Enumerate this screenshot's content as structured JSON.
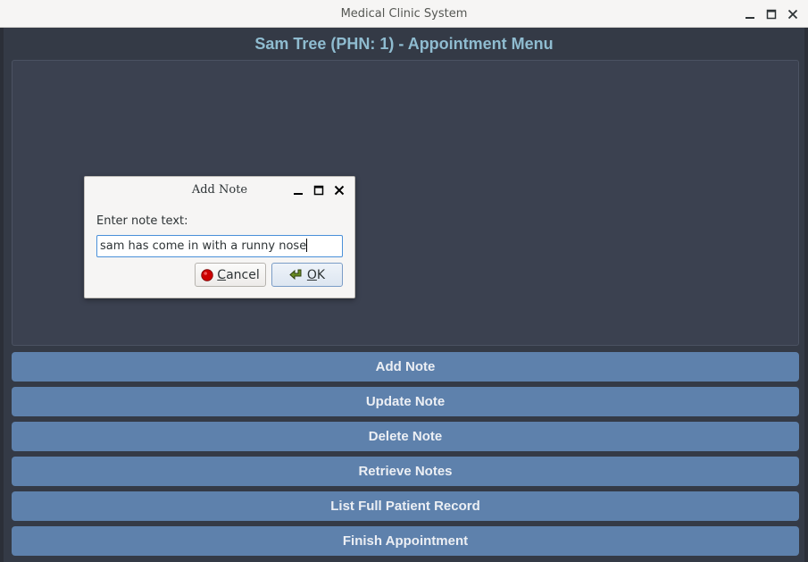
{
  "window": {
    "title": "Medical Clinic System"
  },
  "app": {
    "heading": "Sam Tree (PHN: 1) - Appointment Menu",
    "buttons": [
      {
        "label": "Add Note"
      },
      {
        "label": "Update Note"
      },
      {
        "label": "Delete Note"
      },
      {
        "label": "Retrieve Notes"
      },
      {
        "label": "List Full Patient Record"
      },
      {
        "label": "Finish Appointment"
      }
    ]
  },
  "dialog": {
    "title": "Add Note",
    "prompt": "Enter note text:",
    "input_value": "sam has come in with a runny nose",
    "cancel_label": "Cancel",
    "ok_label": "OK"
  },
  "icons": {
    "minimize": "minimize-icon",
    "maximize": "maximize-icon",
    "close": "close-icon",
    "cancel": "stop-circle-icon",
    "ok": "enter-arrow-icon"
  },
  "colors": {
    "app_background": "#343a46",
    "heading": "#8fbcd0",
    "button": "#5e81ac",
    "button_text": "#eceff4",
    "cancel_icon": "#cc0000",
    "ok_icon": "#6b8e23"
  }
}
